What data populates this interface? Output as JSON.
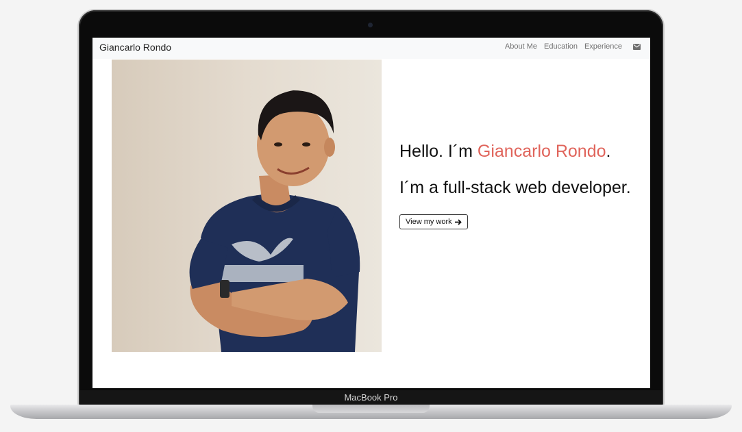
{
  "navbar": {
    "brand": "Giancarlo Rondo",
    "links": [
      "About Me",
      "Education",
      "Experience"
    ],
    "mail_icon": "envelope-icon"
  },
  "hero": {
    "greeting_prefix": "Hello. I´m ",
    "name": "Giancarlo Rondo",
    "greeting_suffix": ".",
    "tagline": "I´m a full-stack web developer.",
    "cta_label": "View my work",
    "cta_icon": "arrow-right-icon"
  },
  "device": {
    "label": "MacBook Pro"
  },
  "colors": {
    "accent": "#e0645b",
    "navbar_bg": "#f8f9fa",
    "shirt": "#1f2f57"
  }
}
